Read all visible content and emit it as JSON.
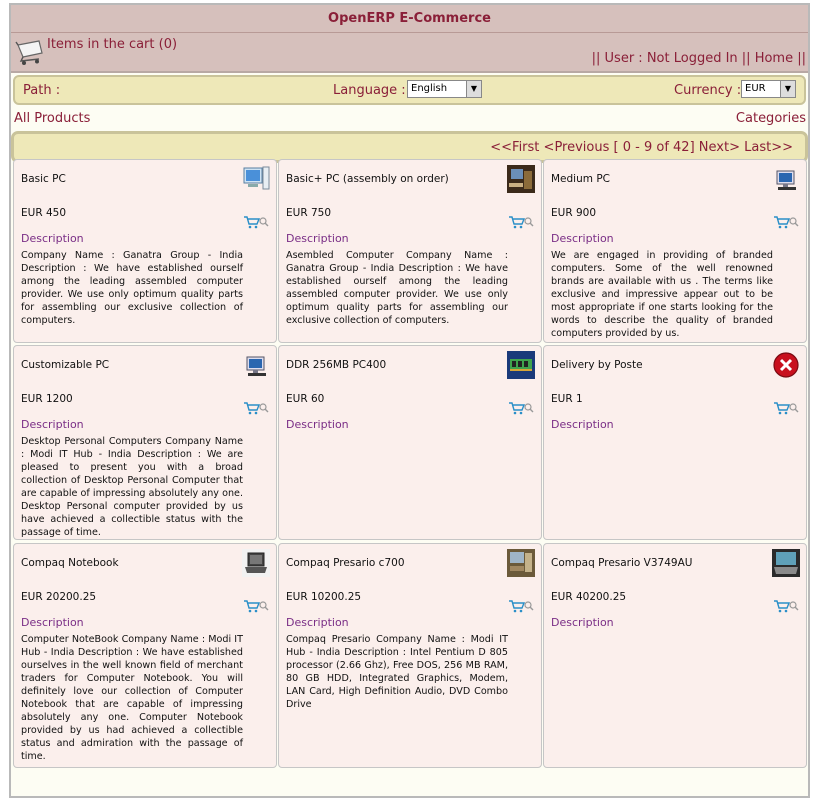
{
  "header": {
    "title": "OpenERP E-Commerce"
  },
  "cart": {
    "text": "Items in the cart (0)"
  },
  "user_links": {
    "sep1": "|| ",
    "user": "User : Not Logged In",
    "sep2": " || ",
    "home": "Home",
    "sep3": " ||"
  },
  "toolbar": {
    "path_label": "Path :",
    "language_label": "Language :",
    "language_value": "English",
    "currency_label": "Currency :",
    "currency_value": "EUR"
  },
  "nav": {
    "all_products": "All Products",
    "categories": "Categories"
  },
  "pager": {
    "first": "<<First",
    "previous": "<Previous",
    "range": "[ 0 - 9 of 42]",
    "next": "Next>",
    "last": "Last>>"
  },
  "desc_label": "Description",
  "products": [
    {
      "name": "Basic PC",
      "price": "EUR 450",
      "image": "desktop-pc-icon",
      "desc": "Company Name : Ganatra Group - India Description : We have established ourself among the leading assembled computer provider. We use only optimum quality parts for assembling our exclusive collection of computers."
    },
    {
      "name": "Basic+ PC (assembly on order)",
      "price": "EUR 750",
      "image": "pc-photo-icon",
      "desc": "Asembled Computer Company Name : Ganatra Group - India Description : We have established ourself among the leading assembled computer provider. We use only optimum quality parts for assembling our exclusive collection of computers."
    },
    {
      "name": "Medium PC",
      "price": "EUR 900",
      "image": "monitor-icon",
      "desc": "We are engaged in providing of branded computers. Some of the well renowned brands are available with us . The terms like exclusive and impressive appear out to be most appropriate if one starts looking for the words to describe the quality of branded computers provided by us."
    },
    {
      "name": "Customizable PC",
      "price": "EUR 1200",
      "image": "monitor-icon",
      "desc": "Desktop Personal Computers Company Name : Modi IT Hub - India Description : We are pleased to present you with a broad collection of Desktop Personal Computer that are capable of impressing absolutely any one. Desktop Personal computer provided by us have achieved a collectible status with the passage of time."
    },
    {
      "name": "DDR 256MB PC400",
      "price": "EUR 60",
      "image": "memory-photo-icon",
      "desc": ""
    },
    {
      "name": "Delivery by Poste",
      "price": "EUR 1",
      "image": "no-image-icon",
      "desc": ""
    },
    {
      "name": "Compaq Notebook",
      "price": "EUR 20200.25",
      "image": "laptop-icon",
      "desc": "Computer NoteBook Company Name : Modi IT Hub - India Description : We have established ourselves in the well known field of merchant traders for Computer Notebook. You will definitely love our collection of Computer Notebook that are capable of impressing absolutely any one. Computer Notebook provided by us had achieved a collectible status and admiration with the passage of time."
    },
    {
      "name": "Compaq Presario c700",
      "price": "EUR 10200.25",
      "image": "presario-photo-icon",
      "desc": "Compaq Presario Company Name : Modi IT Hub - India Description : Intel Pentium D 805 processor (2.66 Ghz), Free DOS, 256 MB RAM, 80 GB HDD, Integrated Graphics, Modem, LAN Card, High Definition Audio, DVD Combo Drive"
    },
    {
      "name": "Compaq Presario V3749AU",
      "price": "EUR 40200.25",
      "image": "presario-laptop-icon",
      "desc": ""
    }
  ],
  "colors": {
    "header_bg": "#d6c0bc",
    "accent": "#8a1f38",
    "toolbar_bg": "#eee8b8",
    "card_bg": "#fbefec",
    "desc_title": "#7a2e86"
  }
}
